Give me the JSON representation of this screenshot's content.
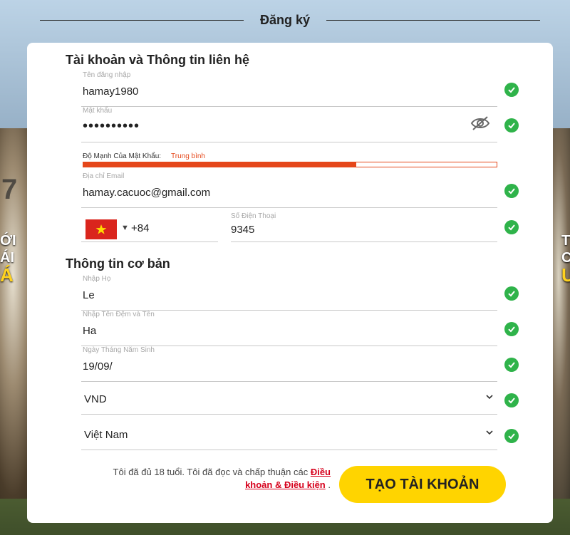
{
  "header": {
    "title": "Đăng ký"
  },
  "side_left": {
    "line1": "ỚI",
    "line2": "ÁI",
    "line3": "Á",
    "num": "7"
  },
  "side_right": {
    "line1": "T",
    "line2": "C",
    "line3": "U"
  },
  "sections": {
    "account": "Tài khoản và Thông tin liên hệ",
    "basic": "Thông tin cơ bản"
  },
  "fields": {
    "username": {
      "label": "Tên đăng nhập",
      "value": "hamay1980"
    },
    "password": {
      "label": "Mật khẩu",
      "value": "••••••••••"
    },
    "strength": {
      "label": "Độ Mạnh Của Mật Khẩu:",
      "level": "Trung bình",
      "fraction": 0.66
    },
    "email": {
      "label": "Địa chỉ Email",
      "value": "hamay.cacuoc@gmail.com"
    },
    "phone_code": {
      "value": "+84"
    },
    "phone": {
      "label": "Số Điện Thoại",
      "value": "9345"
    },
    "last_name": {
      "label": "Nhập Họ",
      "value": "Le"
    },
    "first_name": {
      "label": "Nhập Tên Đệm và Tên",
      "value": "Ha"
    },
    "dob": {
      "label": "Ngày Tháng Năm Sinh",
      "value": "19/09/"
    },
    "currency": {
      "value": "VND"
    },
    "country": {
      "value": "Việt Nam"
    }
  },
  "terms": {
    "text": "Tôi đã đủ 18 tuổi. Tôi đã đọc và chấp thuận các",
    "link_part1": "Điều",
    "link_part2": "khoản & Điều kiện",
    "suffix": " ."
  },
  "submit": {
    "label": "TẠO TÀI KHOẢN"
  },
  "colors": {
    "accent": "#ffd400",
    "check": "#2fb34a",
    "strength": "#e5471a",
    "link": "#d6001c"
  }
}
